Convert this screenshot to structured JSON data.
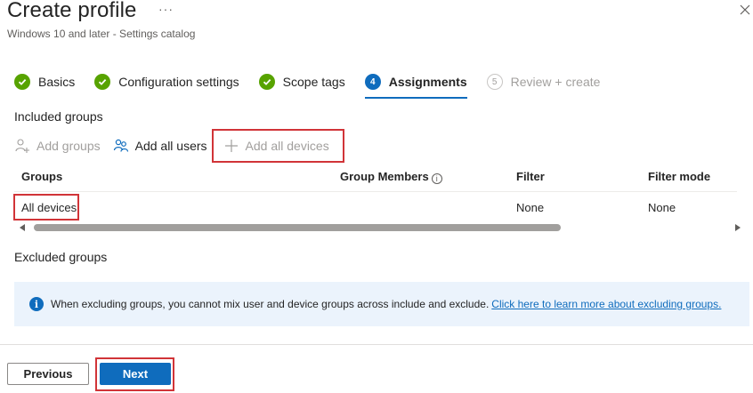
{
  "header": {
    "title": "Create profile",
    "more_label": "···",
    "subtitle": "Windows 10 and later - Settings catalog"
  },
  "steps": [
    {
      "label": "Basics",
      "state": "done"
    },
    {
      "label": "Configuration settings",
      "state": "done"
    },
    {
      "label": "Scope tags",
      "state": "done"
    },
    {
      "number": "4",
      "label": "Assignments",
      "state": "current"
    },
    {
      "number": "5",
      "label": "Review + create",
      "state": "pending"
    }
  ],
  "included": {
    "label": "Included groups",
    "toolbar": {
      "add_groups": "Add groups",
      "add_all_users": "Add all users",
      "add_all_devices": "Add all devices"
    },
    "columns": [
      "Groups",
      "Group Members",
      "Filter",
      "Filter mode"
    ],
    "info_glyph": "i",
    "rows": [
      {
        "group": "All devices",
        "members": "",
        "filter": "None",
        "filter_mode": "None"
      }
    ]
  },
  "excluded": {
    "label": "Excluded groups",
    "info_icon": "i",
    "info_text": "When excluding groups, you cannot mix user and device groups across include and exclude.",
    "info_link": "Click here to learn more about excluding groups."
  },
  "footer": {
    "previous_label": "Previous",
    "next_label": "Next"
  },
  "colors": {
    "accent": "#0f6cbd",
    "success": "#57a300",
    "highlight": "#d13438",
    "info_bg": "#ebf3fc"
  }
}
